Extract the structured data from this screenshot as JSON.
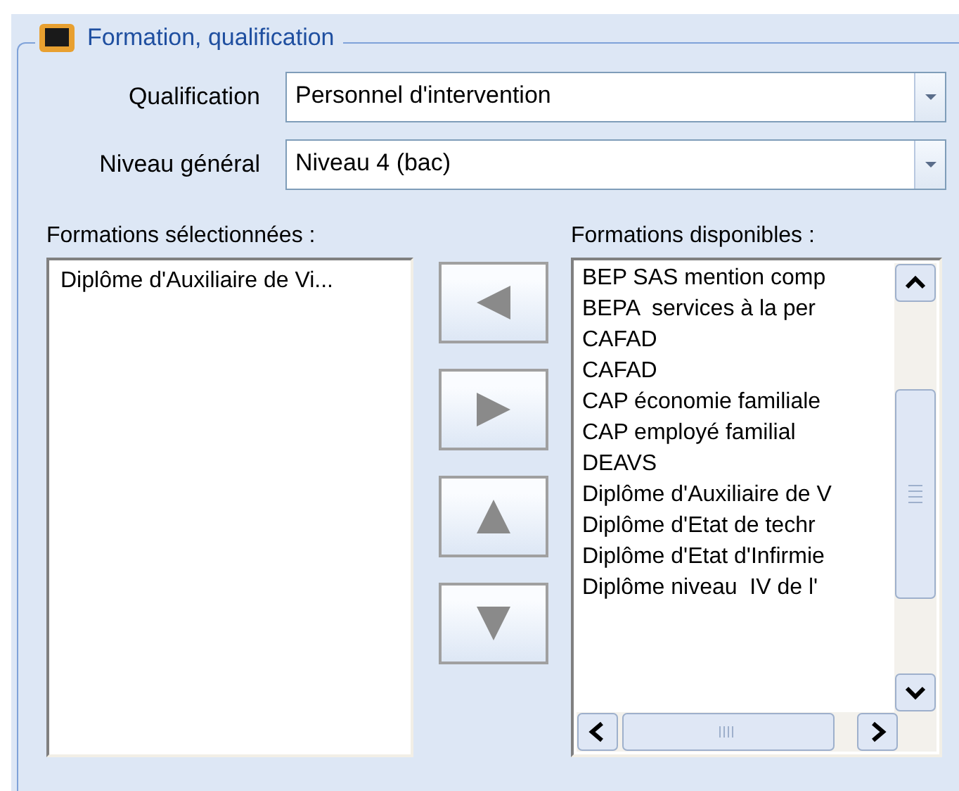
{
  "group": {
    "title": "Formation, qualification"
  },
  "fields": [
    {
      "label": "Qualification",
      "value": "Personnel d'intervention"
    },
    {
      "label": "Niveau général",
      "value": "Niveau 4 (bac)"
    }
  ],
  "selected_list": {
    "label": "Formations sélectionnées :",
    "items": [
      "Diplôme d'Auxiliaire de Vi..."
    ]
  },
  "move_buttons": [
    {
      "kind": "left"
    },
    {
      "kind": "right"
    },
    {
      "kind": "up"
    },
    {
      "kind": "down"
    }
  ],
  "available_list": {
    "label": "Formations disponibles :",
    "items": [
      "BEP SAS mention comp",
      "BEPA  services à la per",
      "CAFAD",
      "CAFAD",
      "CAP économie familiale",
      "CAP employé familial",
      "DEAVS",
      "Diplôme d'Auxiliaire de V",
      "Diplôme d'Etat de techr",
      "Diplôme d'Etat d'Infirmie",
      "Diplôme niveau  IV de l'"
    ]
  }
}
